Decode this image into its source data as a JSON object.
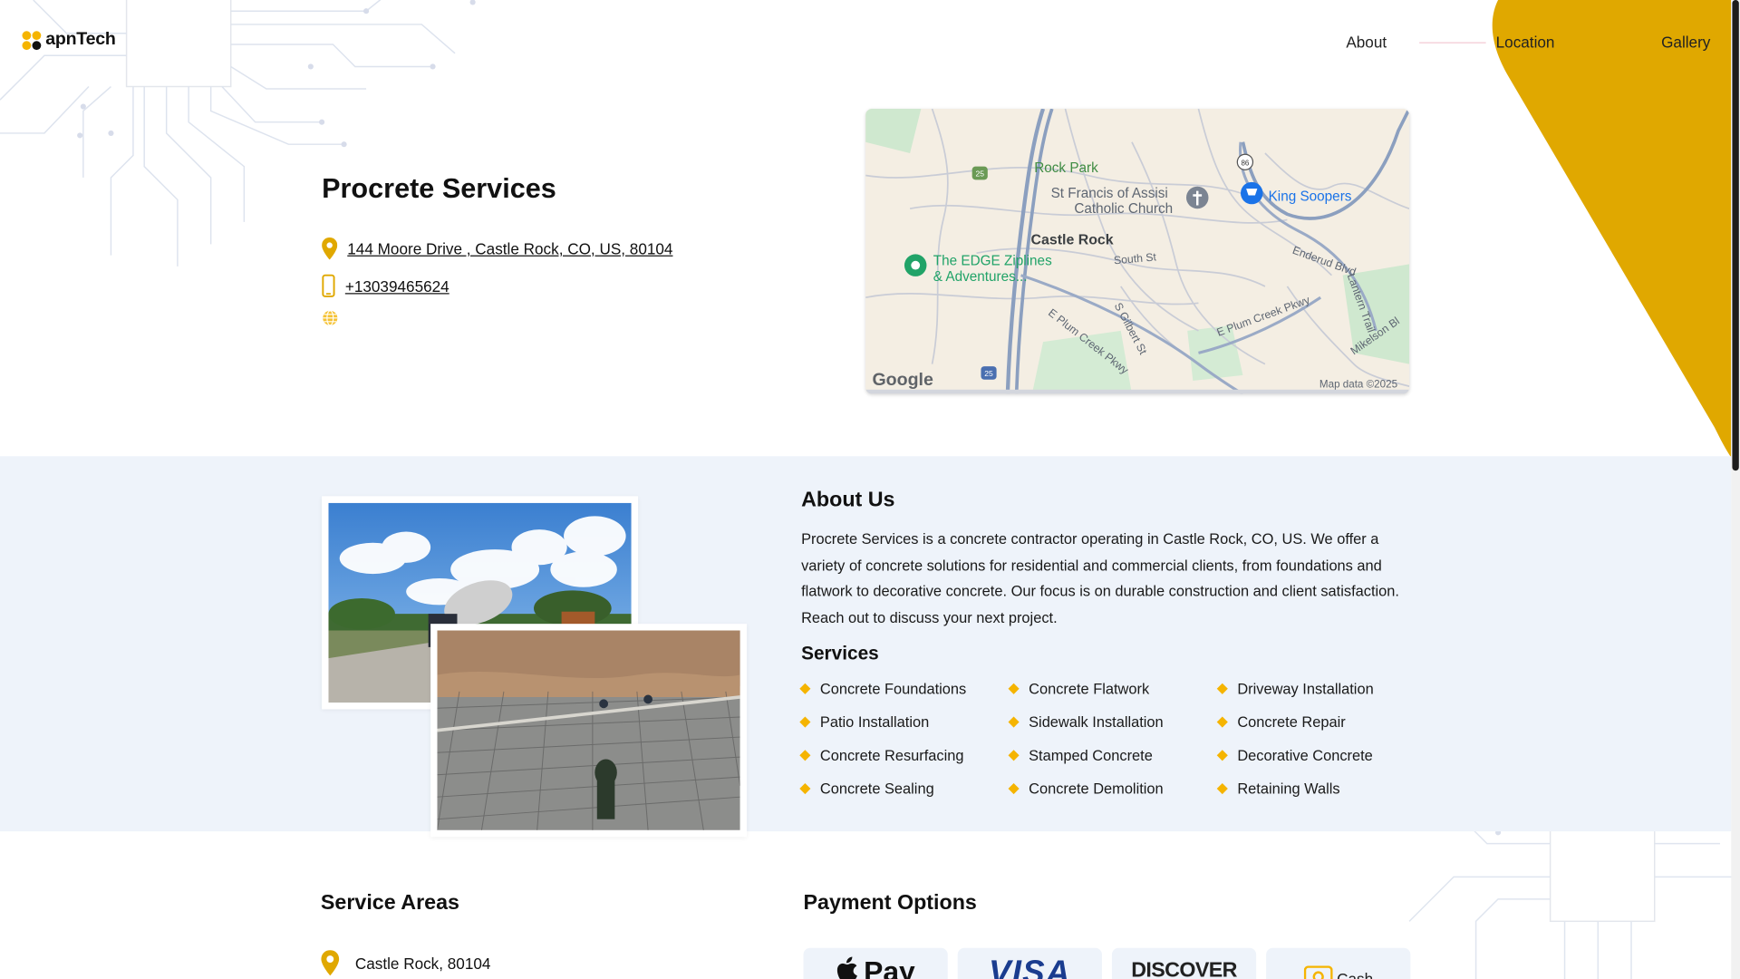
{
  "colors": {
    "accent": "#f5b400",
    "brand_yellow": "#e0a800",
    "band": "#eef3fa"
  },
  "header": {
    "logo_text": "apnTech",
    "nav": [
      {
        "label": "About"
      },
      {
        "label": "Location"
      },
      {
        "label": "Gallery"
      }
    ]
  },
  "business": {
    "name": "Procrete Services",
    "address": "144 Moore Drive , Castle Rock, CO, US, 80104",
    "phone": "+13039465624",
    "icons": [
      "map-pin-icon",
      "phone-icon",
      "globe-icon"
    ]
  },
  "map": {
    "labels": {
      "rock_park": "Rock Park",
      "church_1": "St Francis of Assisi",
      "church_2": "Catholic Church",
      "king_soopers": "King Soopers",
      "castle_rock": "Castle Rock",
      "edge_1": "The EDGE Ziplines",
      "edge_2": "& Adventures...",
      "south_st": "South St",
      "enderud": "Enderud Blvd",
      "lantern": "Lantern Trail",
      "plum_e": "E Plum Creek Pkwy",
      "plum_w": "E Plum Creek Pkwy",
      "gilbert": "S Gilbert St",
      "mikelson": "Mikelson Bl",
      "highway_25": "25",
      "highway_86": "86",
      "google": "Google",
      "map_data": "Map data ©2025"
    }
  },
  "about": {
    "title": "About Us",
    "text": "Procrete Services is a concrete contractor operating in Castle Rock, CO, US. We offer a variety of concrete solutions for residential and commercial clients, from foundations and flatwork to decorative concrete. Our focus is on durable construction and client satisfaction. Reach out to discuss your next project.",
    "services_title": "Services",
    "services": [
      "Concrete Foundations",
      "Concrete Flatwork",
      "Driveway Installation",
      "Patio Installation",
      "Sidewalk Installation",
      "Concrete Repair",
      "Concrete Resurfacing",
      "Stamped Concrete",
      "Decorative Concrete",
      "Concrete Sealing",
      "Concrete Demolition",
      "Retaining Walls"
    ]
  },
  "service_areas": {
    "title": "Service Areas",
    "items": [
      "Castle Rock, 80104"
    ]
  },
  "payment": {
    "title": "Payment Options",
    "methods": [
      "Pay",
      "VISA",
      "DISCOVER",
      "Cash"
    ]
  }
}
